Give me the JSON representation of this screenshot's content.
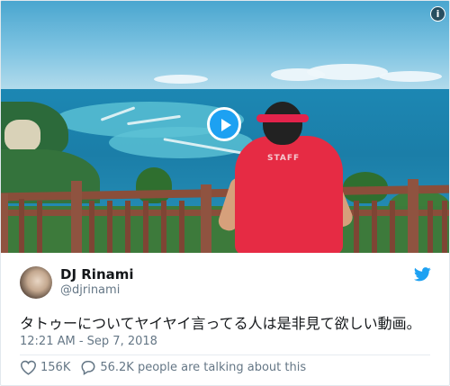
{
  "tweet": {
    "author_name": "DJ Rinami",
    "author_handle": "@djrinami",
    "text": "タトゥーについてヤイヤイ言ってる人は是非見て欲しい動画。",
    "timestamp": "12:21 AM - Sep 7, 2018",
    "likes": "156K",
    "replies_text": "56.2K people are talking about this"
  },
  "media": {
    "shirt_text": "STAFF"
  },
  "icons": {
    "play": "play-icon",
    "info": "info-icon",
    "bird": "twitter-bird-icon",
    "heart": "heart-icon",
    "reply": "reply-bubble-icon"
  },
  "colors": {
    "accent": "#1da1f2",
    "text": "#14171a",
    "muted": "#657786"
  }
}
